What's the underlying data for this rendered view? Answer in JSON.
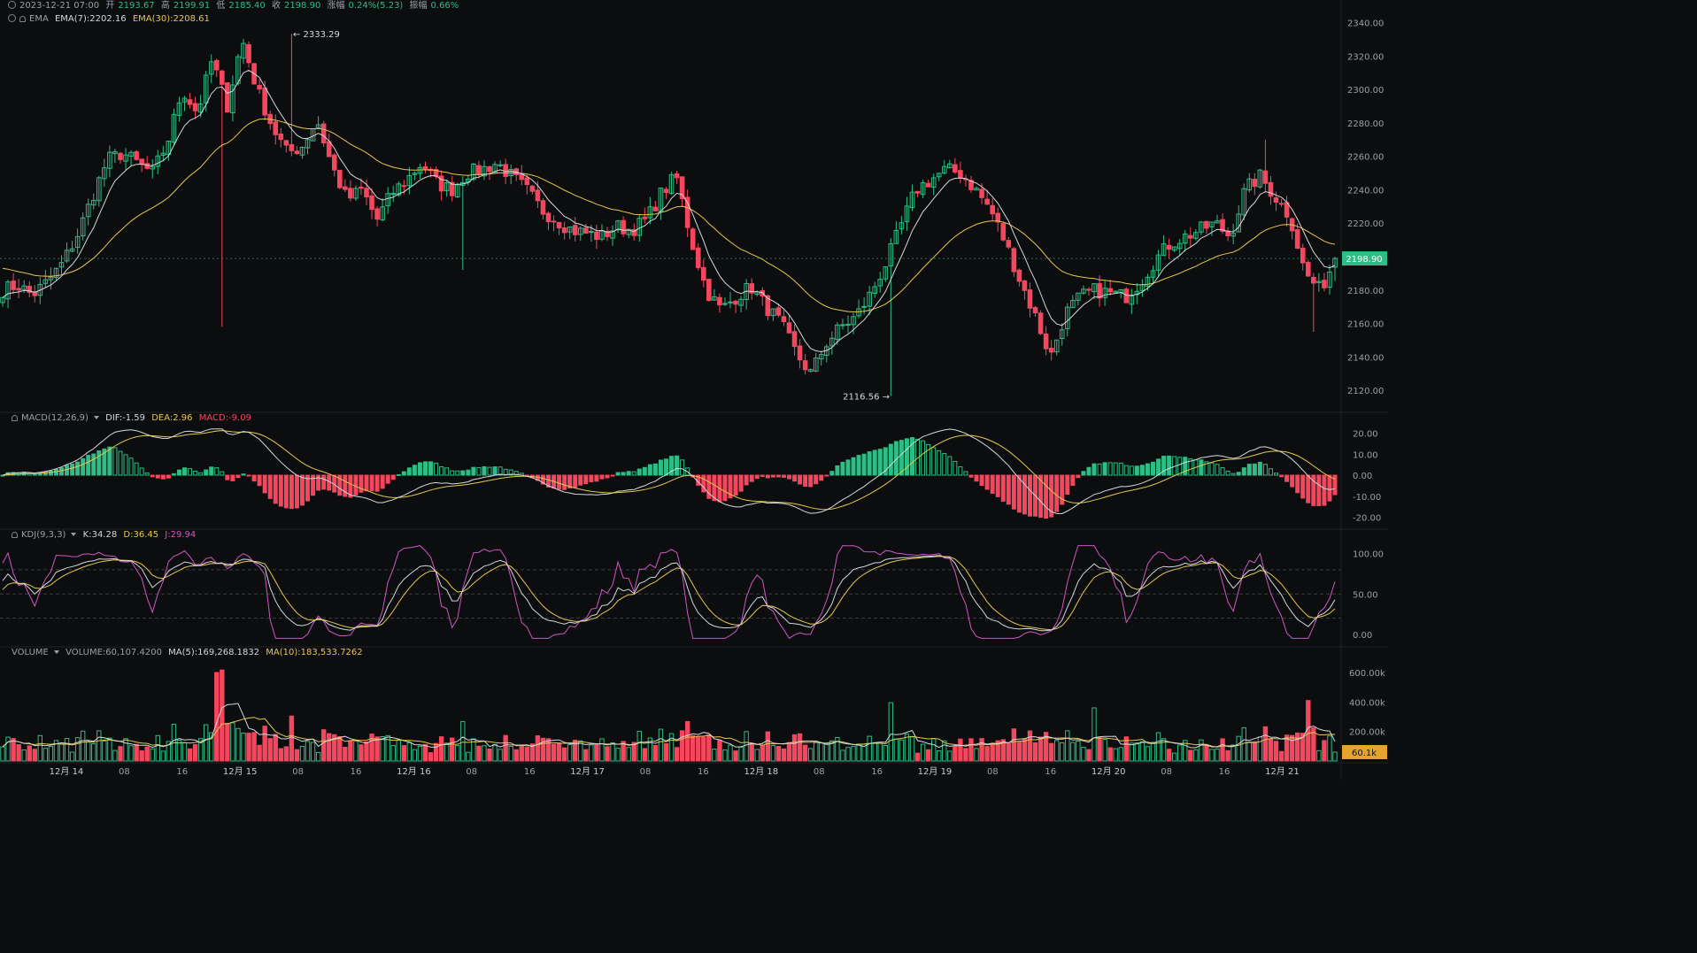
{
  "header": {
    "date": "2023-12-21 07:00",
    "open_label": "开",
    "open": "2193.67",
    "high_label": "高",
    "high": "2199.91",
    "low_label": "低",
    "low": "2185.40",
    "close_label": "收",
    "close": "2198.90",
    "change_label": "涨幅",
    "change": "0.24%(5.23)",
    "amp_label": "振幅",
    "amp": "0.66%"
  },
  "ema_legend": {
    "name": "EMA",
    "ema7": "EMA(7):2202.16",
    "ema30": "EMA(30):2208.61"
  },
  "macd_legend": {
    "name": "MACD(12,26,9)",
    "dif": "DIF:-1.59",
    "dea": "DEA:2.96",
    "macd": "MACD:-9.09"
  },
  "kdj_legend": {
    "name": "KDJ(9,3,3)",
    "k": "K:34.28",
    "d": "D:36.45",
    "j": "J:29.94"
  },
  "vol_legend": {
    "name": "VOLUME",
    "vol": "VOLUME:60,107.4200",
    "ma5": "MA(5):169,268.1832",
    "ma10": "MA(10):183,533.7262"
  },
  "colors": {
    "up": "#2ebd85",
    "down": "#f6465d",
    "ema7": "#d5d8dc",
    "ema30": "#e6c84b",
    "j": "#d156c4",
    "grid": "#1e2126",
    "text": "#9aa0a8"
  },
  "chart_data": [
    {
      "type": "candlestick",
      "pair_note": "",
      "price_axis": {
        "ticks": [
          "2340.00",
          "2320.00",
          "2300.00",
          "2280.00",
          "2260.00",
          "2240.00",
          "2220.00",
          "2200.00",
          "2180.00",
          "2160.00",
          "2140.00",
          "2120.00"
        ],
        "range": [
          2110,
          2344
        ]
      },
      "last_price": "2198.90",
      "high_annotation": "← 2333.29",
      "low_annotation": "2116.56 →",
      "x_axis_labels": [
        "12月 14",
        "08",
        "16",
        "12月 15",
        "08",
        "16",
        "12月 16",
        "08",
        "16",
        "12月 17",
        "08",
        "16",
        "12月 18",
        "08",
        "16",
        "12月 19",
        "08",
        "16",
        "12月 20",
        "08",
        "16",
        "12月 21"
      ],
      "close_path": [
        2180,
        2183,
        2177,
        2185,
        2196,
        2213,
        2236,
        2258,
        2262,
        2256,
        2250,
        2268,
        2300,
        2286,
        2318,
        2290,
        2330,
        2300,
        2278,
        2262,
        2266,
        2282,
        2254,
        2234,
        2240,
        2222,
        2238,
        2246,
        2256,
        2244,
        2240,
        2250,
        2252,
        2256,
        2248,
        2240,
        2228,
        2222,
        2216,
        2214,
        2212,
        2218,
        2216,
        2222,
        2238,
        2248,
        2210,
        2180,
        2168,
        2176,
        2182,
        2170,
        2160,
        2142,
        2130,
        2148,
        2158,
        2164,
        2178,
        2196,
        2218,
        2240,
        2246,
        2252,
        2250,
        2240,
        2228,
        2208,
        2185,
        2164,
        2140,
        2166,
        2176,
        2180,
        2178,
        2176,
        2185,
        2198,
        2208,
        2212,
        2216,
        2220,
        2212,
        2240,
        2248,
        2236,
        2224,
        2190,
        2180,
        2198
      ]
    },
    {
      "type": "bar",
      "name": "MACD",
      "axis_ticks": [
        "20.00",
        "10.00",
        "0.00",
        "-10.00",
        "-20.00"
      ],
      "range": [
        -24,
        24
      ]
    },
    {
      "type": "line",
      "name": "KDJ",
      "axis_ticks": [
        "100.00",
        "50.00",
        "0.00"
      ],
      "range": [
        -10,
        115
      ]
    },
    {
      "type": "bar",
      "name": "VOLUME",
      "axis_ticks": [
        "600.00k",
        "400.00k",
        "200.00k"
      ],
      "last_volume": "60.1k",
      "range": [
        0,
        720
      ]
    }
  ]
}
